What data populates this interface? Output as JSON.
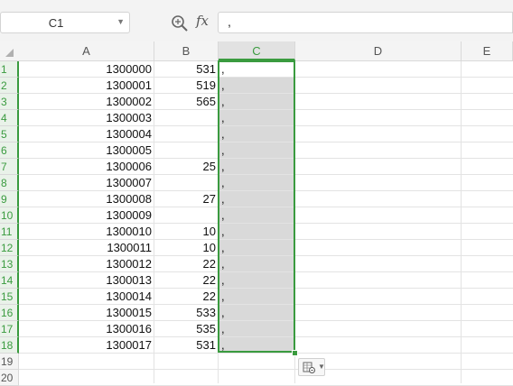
{
  "name_box": {
    "value": "C1"
  },
  "formula_bar": {
    "fx_label": "fx",
    "value": ","
  },
  "columns": [
    "A",
    "B",
    "C",
    "D",
    "E"
  ],
  "selected_column": "C",
  "rows": [
    {
      "num": "1",
      "a": "1300000",
      "b": "531",
      "c": ","
    },
    {
      "num": "2",
      "a": "1300001",
      "b": "519",
      "c": ","
    },
    {
      "num": "3",
      "a": "1300002",
      "b": "565",
      "c": ","
    },
    {
      "num": "4",
      "a": "1300003",
      "b": "",
      "c": ","
    },
    {
      "num": "5",
      "a": "1300004",
      "b": "",
      "c": ","
    },
    {
      "num": "6",
      "a": "1300005",
      "b": "",
      "c": ","
    },
    {
      "num": "7",
      "a": "1300006",
      "b": "25",
      "c": ","
    },
    {
      "num": "8",
      "a": "1300007",
      "b": "",
      "c": ","
    },
    {
      "num": "9",
      "a": "1300008",
      "b": "27",
      "c": ","
    },
    {
      "num": "10",
      "a": "1300009",
      "b": "",
      "c": ","
    },
    {
      "num": "11",
      "a": "1300010",
      "b": "10",
      "c": ","
    },
    {
      "num": "12",
      "a": "1300011",
      "b": "10",
      "c": ","
    },
    {
      "num": "13",
      "a": "1300012",
      "b": "22",
      "c": ","
    },
    {
      "num": "14",
      "a": "1300013",
      "b": "22",
      "c": ","
    },
    {
      "num": "15",
      "a": "1300014",
      "b": "22",
      "c": ","
    },
    {
      "num": "16",
      "a": "1300015",
      "b": "533",
      "c": ","
    },
    {
      "num": "17",
      "a": "1300016",
      "b": "535",
      "c": ","
    },
    {
      "num": "18",
      "a": "1300017",
      "b": "531",
      "c": ","
    },
    {
      "num": "19",
      "a": "",
      "b": "",
      "c": ""
    },
    {
      "num": "20",
      "a": "",
      "b": "",
      "c": ""
    }
  ],
  "selected_row_count": 18,
  "colors": {
    "selection": "#3a9b3f",
    "selection_fill": "#d9d9d9"
  }
}
